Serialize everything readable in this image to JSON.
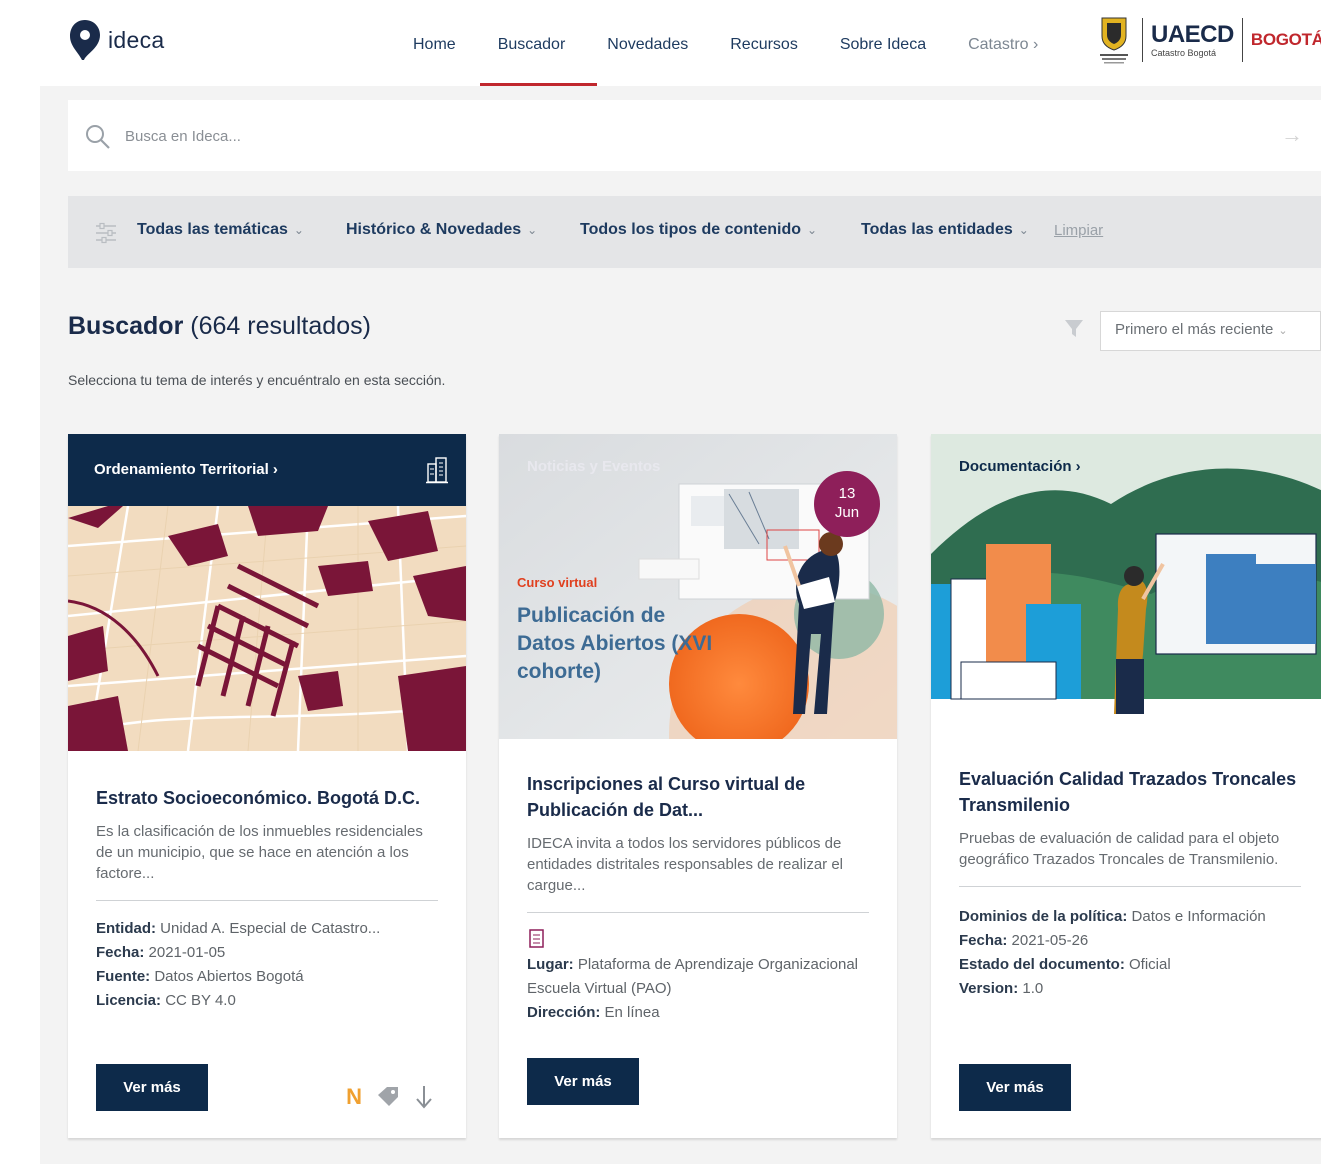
{
  "header": {
    "logo_text": "ideca",
    "nav": [
      {
        "label": "Home"
      },
      {
        "label": "Buscador"
      },
      {
        "label": "Novedades"
      },
      {
        "label": "Recursos"
      },
      {
        "label": "Sobre Ideca"
      },
      {
        "label": "Catastro ›"
      }
    ],
    "uaecd_title": "UAECD",
    "uaecd_sub": "Catastro Bogotá",
    "bogota_text": "BOGOTÁ"
  },
  "search": {
    "placeholder": "Busca en Ideca..."
  },
  "filters": {
    "items": [
      {
        "label": "Todas las temáticas"
      },
      {
        "label": "Histórico & Novedades"
      },
      {
        "label": "Todos los tipos de contenido"
      },
      {
        "label": "Todas las entidades"
      }
    ],
    "clear_label": "Limpiar"
  },
  "results": {
    "title": "Buscador",
    "count_text": "(664 resultados)",
    "sort_label": "Primero el más reciente",
    "subtitle": "Selecciona tu tema de interés y encuéntralo en esta sección."
  },
  "cards": [
    {
      "category": "Ordenamiento Territorial ›",
      "title": "Estrato Socioeconómico. Bogotá D.C.",
      "description": "Es la clasificación de los inmuebles residenciales de un municipio, que se hace en atención a los factore...",
      "meta": [
        {
          "key": "Entidad:",
          "value": "Unidad A. Especial de Catastro..."
        },
        {
          "key": "Fecha:",
          "value": "2021-01-05"
        },
        {
          "key": "Fuente:",
          "value": "Datos Abiertos Bogotá"
        },
        {
          "key": "Licencia:",
          "value": "CC BY 4.0"
        }
      ],
      "button": "Ver más",
      "badge": "N"
    },
    {
      "category": "Noticias y Eventos",
      "date_day": "13",
      "date_month": "Jun",
      "image_small_text": "Curso virtual",
      "image_big_text": "Publicación de Datos Abiertos (XVI cohorte)",
      "title": "Inscripciones al Curso virtual de Publicación de Dat...",
      "description": "IDECA invita a todos los servidores públicos de entidades distritales responsables de realizar el cargue...",
      "meta": [
        {
          "key": "Lugar:",
          "value": "Plataforma de Aprendizaje Organizacional Escuela Virtual (PAO)"
        },
        {
          "key": "Dirección:",
          "value": "En línea"
        }
      ],
      "button": "Ver más"
    },
    {
      "category": "Documentación ›",
      "title": "Evaluación Calidad Trazados Troncales Transmilenio",
      "description": "Pruebas de evaluación de calidad para el objeto geográfico Trazados Troncales de Transmilenio.",
      "meta": [
        {
          "key": "Dominios de la política:",
          "value": "Datos e Información"
        },
        {
          "key": "Fecha:",
          "value": "2021-05-26"
        },
        {
          "key": "Estado del documento:",
          "value": "Oficial"
        },
        {
          "key": "Version:",
          "value": "1.0"
        }
      ],
      "button": "Ver más"
    }
  ],
  "colors": {
    "brand_navy": "#0d2a4a",
    "accent_red": "#c0272d",
    "badge_orange": "#f0a030",
    "date_badge": "#8e1f5a"
  },
  "icons": [
    "ideca-pin-icon",
    "search-icon",
    "arrow-right-icon",
    "filter-sliders-icon",
    "funnel-icon",
    "building-icon",
    "tag-icon",
    "download-icon",
    "document-icon",
    "coat-of-arms-icon"
  ]
}
